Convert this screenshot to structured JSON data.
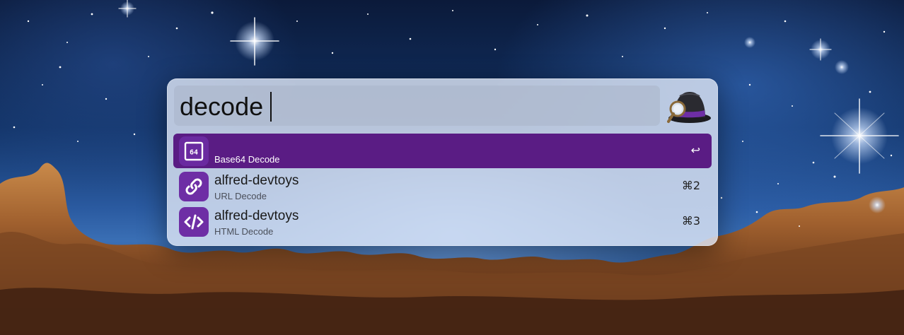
{
  "search": {
    "query": "decode"
  },
  "results": [
    {
      "title": "",
      "subtitle": "Base64 Decode",
      "shortcut": "↩",
      "icon": "base64-icon",
      "icon_text": "64",
      "selected": true
    },
    {
      "title": "alfred-devtoys",
      "subtitle": "URL Decode",
      "shortcut": "⌘2",
      "icon": "link-icon",
      "selected": false
    },
    {
      "title": "alfred-devtoys",
      "subtitle": "HTML Decode",
      "shortcut": "⌘3",
      "icon": "code-icon",
      "selected": false
    }
  ],
  "colors": {
    "selection": "#5a1c84",
    "icon_bg": "#6e2ea5",
    "panel": "#dde5f5"
  }
}
